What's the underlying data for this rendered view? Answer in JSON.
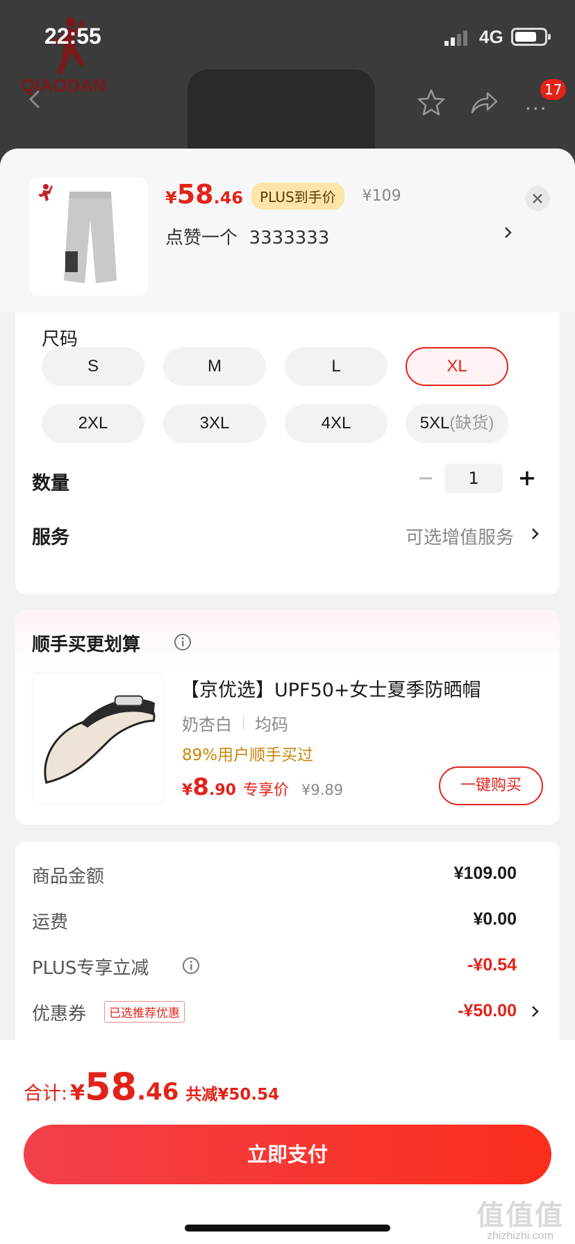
{
  "status_bar": {
    "time": "22:55",
    "network": "4G"
  },
  "background_page": {
    "brand": "QIAODAN",
    "cart_badge": "17"
  },
  "product": {
    "price_yen": "¥",
    "price_int": "58",
    "price_dec": ".46",
    "plus_tag": "PLUS到手价",
    "original_price": "¥109",
    "selected_spec": "点赞一个  3333333"
  },
  "size": {
    "title": "尺码",
    "options": [
      {
        "label": "S",
        "state": "normal"
      },
      {
        "label": "M",
        "state": "normal"
      },
      {
        "label": "L",
        "state": "normal"
      },
      {
        "label": "XL",
        "state": "selected"
      },
      {
        "label": "2XL",
        "state": "normal"
      },
      {
        "label": "3XL",
        "state": "normal"
      },
      {
        "label": "4XL",
        "state": "normal"
      },
      {
        "label": "5XL",
        "note": "(缺货)",
        "state": "out_of_stock"
      }
    ]
  },
  "quantity": {
    "label": "数量",
    "value": "1"
  },
  "service": {
    "label": "服务",
    "value": "可选增值服务"
  },
  "combo": {
    "title": "顺手买更划算",
    "name": "【京优选】UPF50+女士夏季防晒帽",
    "spec_color": "奶杏白",
    "spec_size": "均码",
    "bought": "89%用户顺手买过",
    "price_yen": "¥",
    "price_int": "8",
    "price_dec": ".90",
    "price_label": "专享价",
    "original_price": "¥9.89",
    "buy_label": "一键购买"
  },
  "amounts": {
    "rows": [
      {
        "label": "商品金额",
        "value": "¥109.00"
      },
      {
        "label": "运费",
        "value": "¥0.00"
      },
      {
        "label": "PLUS专享立减",
        "value": "-¥0.54"
      },
      {
        "label": "优惠券",
        "value": "-¥50.00"
      }
    ],
    "coupon_tag": "已选推荐优惠"
  },
  "footer": {
    "total_label": "合计:",
    "total_yen": "¥",
    "total_int": "58",
    "total_dec": ".46",
    "total_save": "共减¥50.54",
    "pay_label": "立即支付"
  },
  "watermark": {
    "big": "值值值",
    "small": "zhizhizhi.com"
  },
  "colors": {
    "accent": "#e2231a",
    "plus_tag_bg": "#fbe6a8",
    "bought_text": "#c8850a"
  }
}
